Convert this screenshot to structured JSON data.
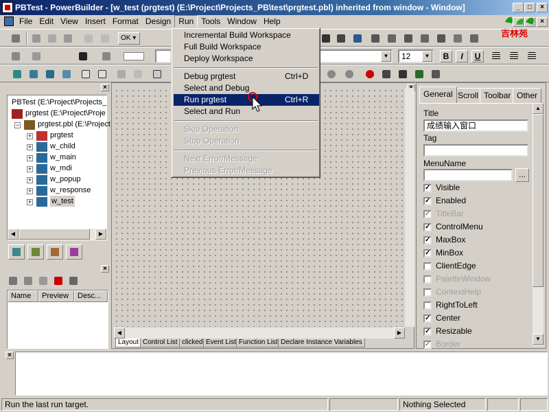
{
  "window": {
    "title": "PBTest - PowerBuilder - [w_test (prgtest) (E:\\Project\\Projects_PB\\test\\prgtest.pbl) inherited from window - Window]"
  },
  "menubar": {
    "items": [
      "File",
      "Edit",
      "View",
      "Insert",
      "Format",
      "Design",
      "Run",
      "Tools",
      "Window",
      "Help"
    ]
  },
  "toolbar": {
    "font_size": "12",
    "bold": "B",
    "italic": "I",
    "underline": "U",
    "ok_label": "OK",
    "watermark": "吉林苑"
  },
  "run_menu": {
    "items": [
      {
        "label": "Incremental Build Workspace",
        "shortcut": ""
      },
      {
        "label": "Full Build Workspace",
        "shortcut": ""
      },
      {
        "label": "Deploy Workspace",
        "shortcut": ""
      },
      {
        "label": "Debug prgtest",
        "shortcut": "Ctrl+D"
      },
      {
        "label": "Select and Debug",
        "shortcut": ""
      },
      {
        "label": "Run prgtest",
        "shortcut": "Ctrl+R"
      },
      {
        "label": "Select and Run",
        "shortcut": ""
      },
      {
        "label": "Skip Operation",
        "shortcut": ""
      },
      {
        "label": "Stop Operation",
        "shortcut": ""
      },
      {
        "label": "Next Error/Message",
        "shortcut": ""
      },
      {
        "label": "Previous Error/Message",
        "shortcut": ""
      }
    ]
  },
  "tree": {
    "root": "PBTest (E:\\Project\\Projects_",
    "target": "prgtest (E:\\Project\\Proje",
    "library": "prgtest.pbl (E:\\Project",
    "objects": [
      "prgtest",
      "w_child",
      "w_main",
      "w_mdi",
      "w_popup",
      "w_response",
      "w_test"
    ]
  },
  "list_panel": {
    "columns": [
      "Name",
      "Preview",
      "Desc..."
    ]
  },
  "layout_tabs": [
    "Layout",
    "Control List",
    "clicked",
    "Event List",
    "Function List",
    "Declare Instance Variables"
  ],
  "properties": {
    "tabs": [
      "General",
      "Scroll",
      "Toolbar",
      "Other"
    ],
    "title_label": "Title",
    "title_value": "成绩输入窗口",
    "tag_label": "Tag",
    "tag_value": "",
    "menuname_label": "MenuName",
    "menuname_value": "",
    "browse_label": "...",
    "checks": [
      {
        "label": "Visible",
        "checked": true,
        "disabled": false
      },
      {
        "label": "Enabled",
        "checked": true,
        "disabled": false
      },
      {
        "label": "TitleBar",
        "checked": true,
        "disabled": true
      },
      {
        "label": "ControlMenu",
        "checked": true,
        "disabled": false
      },
      {
        "label": "MaxBox",
        "checked": true,
        "disabled": false
      },
      {
        "label": "MinBox",
        "checked": true,
        "disabled": false
      },
      {
        "label": "ClientEdge",
        "checked": false,
        "disabled": false
      },
      {
        "label": "PaletteWindow",
        "checked": false,
        "disabled": true
      },
      {
        "label": "ContextHelp",
        "checked": false,
        "disabled": true
      },
      {
        "label": "RightToLeft",
        "checked": false,
        "disabled": false
      },
      {
        "label": "Center",
        "checked": true,
        "disabled": false
      },
      {
        "label": "Resizable",
        "checked": true,
        "disabled": false
      },
      {
        "label": "Border",
        "checked": true,
        "disabled": true
      }
    ]
  },
  "status": {
    "message": "Run the last run target.",
    "selection": "Nothing Selected"
  },
  "colors": {
    "title_start": "#0a246a",
    "highlight": "#0a246a",
    "face": "#d4d0c8"
  }
}
